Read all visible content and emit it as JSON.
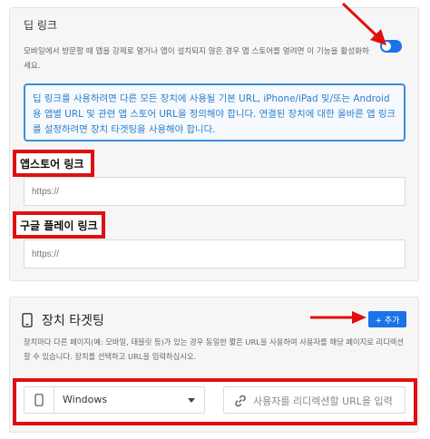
{
  "deeplink": {
    "title": "딥 링크",
    "description": "모바일에서 방문할 때 앱을 강제로 열거나 앱이 설치되지 않은 경우 앱 스토어를 열려면 이 기능을 활성화하세요.",
    "info_text": "딥 링크를 사용하려면 다른 모든 장치에 사용될 기본 URL, iPhone/iPad 및/또는 Android용 앱별 URL 및 관련 앱 스토어 URL을 정의해야 합니다. 연결된 장치에 대한 올바른 앱 링크를 설정하려면 장치 타겟팅을 사용해야 합니다.",
    "appstore_label": "앱스토어 링크",
    "appstore_placeholder": "https://",
    "googleplay_label": "구글 플레이 링크",
    "googleplay_placeholder": "https://",
    "toggle_on": true
  },
  "targeting": {
    "title": "장치 타겟팅",
    "add_label": "+ 추가",
    "description": "장치마다 다른 페이지(예: 모바일, 태블릿 등)가 있는 경우 동일한 짧은 URL을 사용하여 사용자를 해당 페이지로 리디렉션할 수 있습니다. 장치를 선택하고 URL을 입력하십시오.",
    "device_value": "Windows",
    "url_placeholder": "사용자를 리디렉션할 URL을 입력"
  },
  "colors": {
    "accent": "#1a73e8",
    "highlight": "#e01010",
    "info": "#3b8fd9"
  }
}
